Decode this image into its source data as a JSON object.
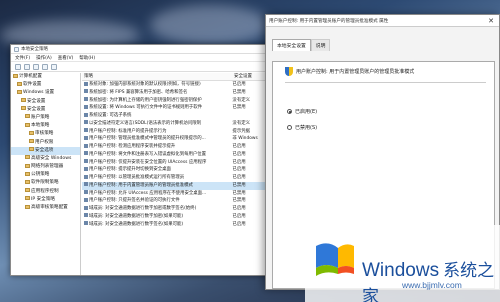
{
  "mmc": {
    "title": "本地安全策略",
    "menu": [
      "文件(F)",
      "操作(A)",
      "查看(V)",
      "帮助(H)"
    ],
    "tree": [
      "安全设置",
      "账户策略",
      "本地策略",
      "Windows 设置",
      "计算机配置",
      "软件设置",
      "Windows 设置",
      "安全设置",
      "账户策略",
      "本地策略",
      "审核策略",
      "用户权限",
      "安全选项",
      "高级安全 Windows",
      "网络列表管理器",
      "公钥策略",
      "软件限制策略",
      "应用程序控制",
      "IP 安全策略",
      "高级审核策略配置"
    ],
    "columns": [
      "策略",
      "安全设置"
    ],
    "rows": [
      [
        "系统对象: 加强内部系统对象的默认权限(例如，符号链接)",
        "已启用"
      ],
      [
        "系统加密: 将 FIPS 兼容算法用于加密、哈希和签名",
        "已禁用"
      ],
      [
        "系统加密: 为计算机上存储的用户密钥强制进行强密钥保护",
        "没有定义"
      ],
      [
        "系统设置: 将 Windows 可执行文件中的证书规则用于软件",
        "已禁用"
      ],
      [
        "系统设置: 可选子系统",
        ""
      ],
      [
        "以安全描述符定义语言(SDDL)语法表示的计算机访问限制",
        "没有定义"
      ],
      [
        "用户账户控制: 标准用户的提升提示行为",
        "提示凭据"
      ],
      [
        "用户账户控制: 管理员批准模式中管理员的提升权限提示的...",
        "非 Windows"
      ],
      [
        "用户账户控制: 检测应用程序安装并提示提升",
        "已启用"
      ],
      [
        "用户账户控制: 将文件和注册表写入错误虚拟化到每用户位置",
        "已启用"
      ],
      [
        "用户账户控制: 仅提升安装在安全位置的 UIAccess 应用程序",
        "已启用"
      ],
      [
        "用户账户控制: 提示提升时切换到安全桌面",
        "已启用"
      ],
      [
        "用户账户控制: 以管理员批准模式运行所有管理员",
        "已启用"
      ],
      [
        "用户账户控制: 用于内置管理员账户的管理员批准模式",
        "已禁用"
      ],
      [
        "用户账户控制: 允许 UIAccess 应用程序在不使用安全桌面...",
        "已禁用"
      ],
      [
        "用户账户控制: 只提升签名并验证的可执行文件",
        "已禁用"
      ],
      [
        "域成员: 对安全通道数据进行数字加密或数字签名(始终)",
        "已启用"
      ],
      [
        "域成员: 对安全通道数据进行数字加密(如果可能)",
        "已启用"
      ],
      [
        "域成员: 对安全通道数据进行数字签名(如果可能)",
        "已启用"
      ]
    ]
  },
  "dialog": {
    "title": "用户账户控制: 用于内置管理员账户的管理员批准模式 属性",
    "tabs": [
      "本地安全设置",
      "说明"
    ],
    "policy_title": "用户账户控制: 用于内置管理员账户的管理员批准模式",
    "options": [
      "已启用(E)",
      "已禁用(S)"
    ],
    "selected": "已启用(E)"
  },
  "watermark": {
    "brand": "Windows",
    "suffix": "系统之家",
    "url": "www.bjjmlv.com"
  }
}
